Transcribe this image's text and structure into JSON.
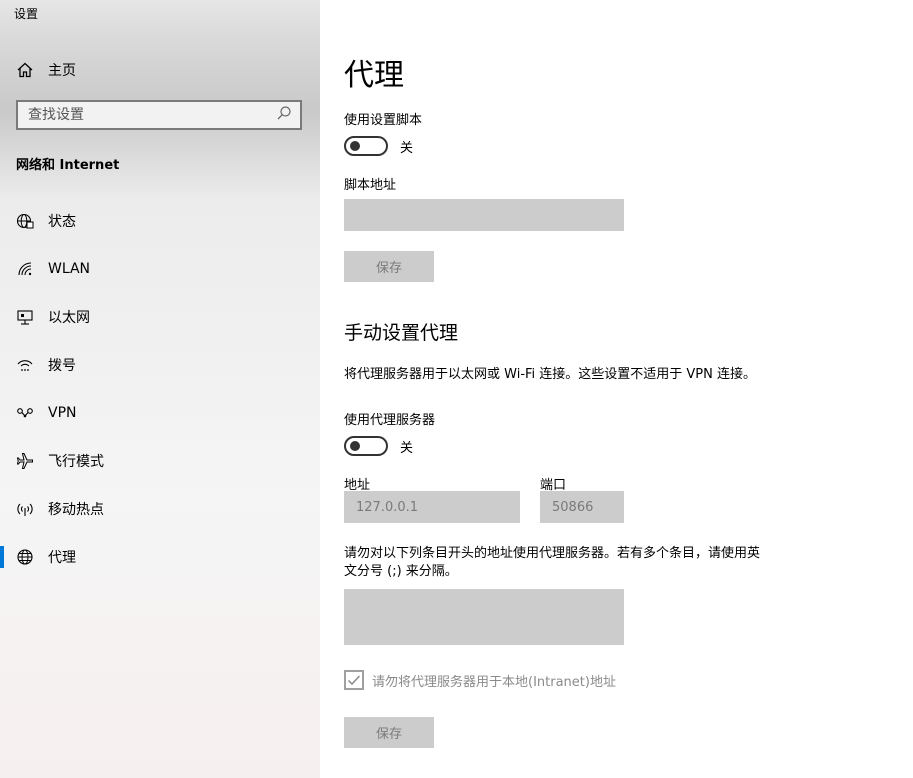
{
  "window": {
    "title": "设置"
  },
  "sidebar": {
    "home_label": "主页",
    "search_placeholder": "查找设置",
    "section_title": "网络和 Internet",
    "items": [
      {
        "label": "状态",
        "icon": "globe-status-icon"
      },
      {
        "label": "WLAN",
        "icon": "wifi-icon"
      },
      {
        "label": "以太网",
        "icon": "ethernet-icon"
      },
      {
        "label": "拨号",
        "icon": "dialup-icon"
      },
      {
        "label": "VPN",
        "icon": "vpn-icon"
      },
      {
        "label": "飞行模式",
        "icon": "airplane-icon"
      },
      {
        "label": "移动热点",
        "icon": "hotspot-icon"
      },
      {
        "label": "代理",
        "icon": "globe-icon",
        "active": true
      }
    ]
  },
  "main": {
    "title": "代理",
    "auto": {
      "script_toggle_label": "使用设置脚本",
      "script_toggle_state": "关",
      "script_address_label": "脚本地址",
      "script_address_value": "",
      "save_label": "保存"
    },
    "manual": {
      "heading": "手动设置代理",
      "description": "将代理服务器用于以太网或 Wi-Fi 连接。这些设置不适用于 VPN 连接。",
      "proxy_toggle_label": "使用代理服务器",
      "proxy_toggle_state": "关",
      "address_label": "地址",
      "address_value": "127.0.0.1",
      "port_label": "端口",
      "port_value": "50866",
      "exceptions_desc_line1": "请勿对以下列条目开头的地址使用代理服务器。若有多个条目，请使用英",
      "exceptions_desc_line2": "文分号 (;) 来分隔。",
      "exceptions_value": "",
      "local_checkbox_label": "请勿将代理服务器用于本地(Intranet)地址",
      "local_checkbox_checked": true,
      "save_label": "保存"
    }
  },
  "colors": {
    "accent": "#0078d7",
    "disabled_field": "#cccccc",
    "disabled_text": "#7a7a7a"
  }
}
